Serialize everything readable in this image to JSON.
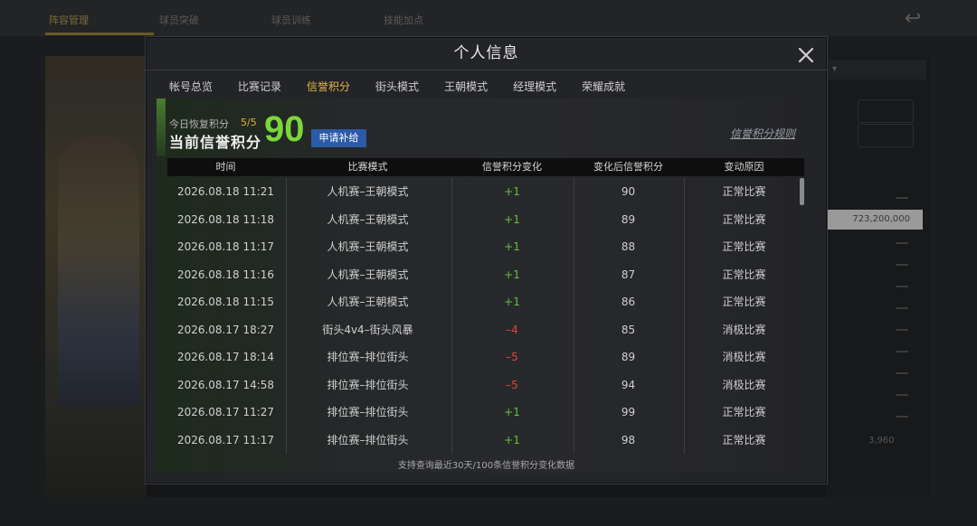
{
  "background": {
    "tabs": [
      "阵容管理",
      "球员突破",
      "球员训练",
      "技能加点"
    ],
    "right_values": [
      "723,200,000",
      "3,960"
    ]
  },
  "modal": {
    "title": "个人信息",
    "tabs": [
      {
        "label": "帐号总览",
        "active": false
      },
      {
        "label": "比赛记录",
        "active": false
      },
      {
        "label": "信誉积分",
        "active": true
      },
      {
        "label": "街头模式",
        "active": false
      },
      {
        "label": "王朝模式",
        "active": false
      },
      {
        "label": "经理模式",
        "active": false
      },
      {
        "label": "荣耀成就",
        "active": false
      }
    ],
    "summary": {
      "recover_label": "今日恢复积分",
      "recover_value": "5/5",
      "current_label": "当前信誉积分",
      "score": "90",
      "apply_button": "申请补给",
      "rules_link": "信誉积分规则"
    },
    "table": {
      "headers": [
        "时间",
        "比赛模式",
        "信誉积分变化",
        "变化后信誉积分",
        "变动原因"
      ],
      "rows": [
        {
          "time": "2026.08.18  11:21",
          "mode": "人机赛–王朝模式",
          "change": "+1",
          "after": "90",
          "reason": "正常比赛"
        },
        {
          "time": "2026.08.18  11:18",
          "mode": "人机赛–王朝模式",
          "change": "+1",
          "after": "89",
          "reason": "正常比赛"
        },
        {
          "time": "2026.08.18  11:17",
          "mode": "人机赛–王朝模式",
          "change": "+1",
          "after": "88",
          "reason": "正常比赛"
        },
        {
          "time": "2026.08.18  11:16",
          "mode": "人机赛–王朝模式",
          "change": "+1",
          "after": "87",
          "reason": "正常比赛"
        },
        {
          "time": "2026.08.18  11:15",
          "mode": "人机赛–王朝模式",
          "change": "+1",
          "after": "86",
          "reason": "正常比赛"
        },
        {
          "time": "2026.08.17  18:27",
          "mode": "街头4v4–街头风暴",
          "change": "–4",
          "after": "85",
          "reason": "消极比赛"
        },
        {
          "time": "2026.08.17  18:14",
          "mode": "排位赛–排位街头",
          "change": "–5",
          "after": "89",
          "reason": "消极比赛"
        },
        {
          "time": "2026.08.17  14:58",
          "mode": "排位赛–排位街头",
          "change": "–5",
          "after": "94",
          "reason": "消极比赛"
        },
        {
          "time": "2026.08.17  11:27",
          "mode": "排位赛–排位街头",
          "change": "+1",
          "after": "99",
          "reason": "正常比赛"
        },
        {
          "time": "2026.08.17  11:17",
          "mode": "排位赛–排位街头",
          "change": "+1",
          "after": "98",
          "reason": "正常比赛"
        }
      ],
      "footer_note": "支持查询最近30天/100条信誉积分变化数据"
    },
    "colors": {
      "positive": "#64c03a",
      "negative": "#e0443a",
      "accent": "#d9a535",
      "score": "#7bd63a"
    }
  }
}
